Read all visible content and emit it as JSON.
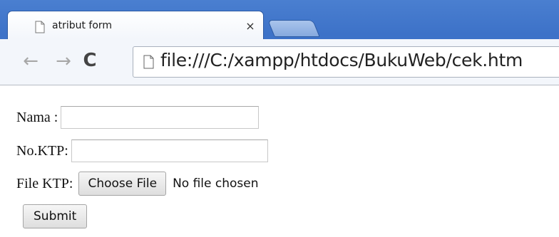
{
  "browser": {
    "tab": {
      "title": "atribut form",
      "close_glyph": "×",
      "icon": "page-icon"
    },
    "new_tab": {
      "icon": "new-tab-shape"
    },
    "toolbar": {
      "back_glyph": "←",
      "forward_glyph": "→",
      "reload_glyph": "C",
      "url": "file:///C:/xampp/htdocs/BukuWeb/cek.htm",
      "url_icon": "page-icon"
    },
    "colors": {
      "frame": "#3d72c8",
      "toolbar": "#f3f6fb"
    }
  },
  "form": {
    "nama": {
      "label": "Nama :",
      "value": ""
    },
    "ktp": {
      "label": "No.KTP:",
      "value": ""
    },
    "file": {
      "label": "File KTP:",
      "button_label": "Choose File",
      "status": "No file chosen"
    },
    "submit": {
      "label": "Submit"
    }
  }
}
